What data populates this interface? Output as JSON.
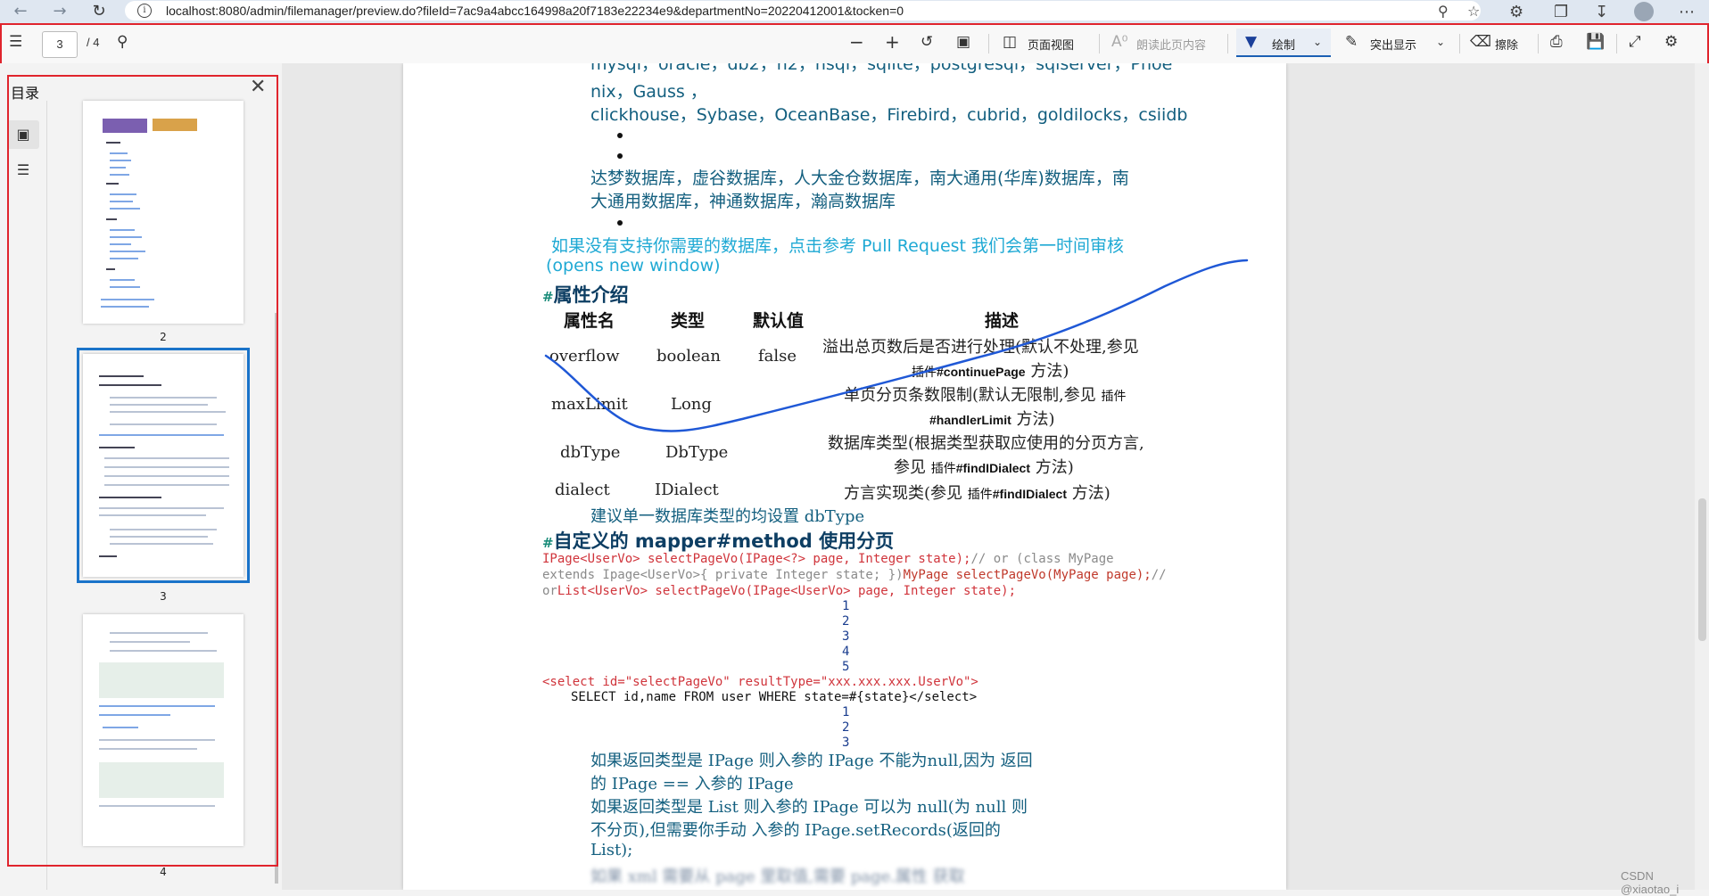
{
  "browser": {
    "url": "localhost:8080/admin/filemanager/preview.do?fileId=7ac9a4abcc164998a20f7183e22234e9&departmentNo=20220412001&tocken=0"
  },
  "toolbar": {
    "current_page": "3",
    "total_pages": "/ 4",
    "page_view_label": "页面视图",
    "read_aloud_label": "朗读此页内容",
    "draw_label": "绘制",
    "highlight_label": "突出显示",
    "erase_label": "擦除"
  },
  "sidebar": {
    "title": "目录",
    "thumbnails": [
      {
        "label": "2"
      },
      {
        "label": "3"
      },
      {
        "label": "4"
      }
    ]
  },
  "document": {
    "line_top_partial": "mysql，oracle，db2，h2，hsql，sqlite，postgresql，sqlserver，Phoe",
    "line_nix": "nix，Gauss ，",
    "line_clickhouse": "clickhouse，Sybase，OceanBase，Firebird，cubrid，goldilocks，csiidb",
    "line_dameng_1": "达梦数据库，虚谷数据库，人大金仓数据库，南大通用(华库)数据库，南",
    "line_dameng_2": "大通用数据库，神通数据库，瀚高数据库",
    "line_support_1": "如果没有支持你需要的数据库，点击参考 Pull Request 我们会第一时间审核",
    "line_support_2": "(opens new window)",
    "heading_props": "属性介绍",
    "heading_hash": "#",
    "table": {
      "headers": [
        "属性名",
        "类型",
        "默认值",
        "描述"
      ],
      "rows": [
        {
          "name": "overflow",
          "type": "boolean",
          "default": "false",
          "desc_1": "溢出总页数后是否进行处理(默认不处理,参见",
          "desc_2_small": "插件",
          "desc_2_code": "#continuePage",
          "desc_2_tail": "方法)"
        },
        {
          "name": "maxLimit",
          "type": "Long",
          "default": "",
          "desc_1": "单页分页条数限制(默认无限制,参见",
          "desc_1_small": "插件",
          "desc_2_code": "#handlerLimit",
          "desc_2_tail": "方法)"
        },
        {
          "name": "dbType",
          "type": "DbType",
          "default": "",
          "desc_1": "数据库类型(根据类型获取应使用的分页方言,",
          "desc_2_pre": "参见",
          "desc_2_small": "插件",
          "desc_2_code": "#findIDialect",
          "desc_2_tail": "方法)"
        },
        {
          "name": "dialect",
          "type": "IDialect",
          "default": "",
          "desc_1": "方言实现类(参见",
          "desc_1_small": "插件",
          "desc_1_code": "#findIDialect",
          "desc_1_tail": "方法)"
        }
      ]
    },
    "line_suggest": "建议单一数据库类型的均设置 dbType",
    "heading_mapper": "自定义的 mapper#method 使用分页",
    "code1_line1_a": "IPage<UserVo> selectPageVo(IPage<?> page, Integer state);",
    "code1_line1_b": "// or (class MyPage",
    "code1_line2_a": "extends Ipage<UserVo>{ private Integer state; })",
    "code1_line2_b": "MyPage selectPageVo(MyPage page);",
    "code1_line2_c": "//",
    "code1_line3_a": "or",
    "code1_line3_b": "List<UserVo> selectPageVo(IPage<UserVo> page, Integer state);",
    "line_numbers_1": [
      "1",
      "2",
      "3",
      "4",
      "5"
    ],
    "code2_line1": "<select id=\"selectPageVo\" resultType=\"xxx.xxx.xxx.UserVo\">",
    "code2_line2": "SELECT id,name FROM user WHERE state=#{state}</select>",
    "line_numbers_2": [
      "1",
      "2",
      "3"
    ],
    "para_1": "如果返回类型是 IPage 则入参的 IPage 不能为null,因为 返回",
    "para_2": "的 IPage == 入参的 IPage",
    "para_3": "如果返回类型是 List 则入参的 IPage 可以为 null(为 null 则",
    "para_4": "不分页),但需要你手动 入参的 IPage.setRecords(返回的",
    "para_5": "List);",
    "para_6": "如果 xml 需要从 page 里取值,需要 page.属性 获取"
  },
  "watermark": "CSDN @xiaotao_i"
}
